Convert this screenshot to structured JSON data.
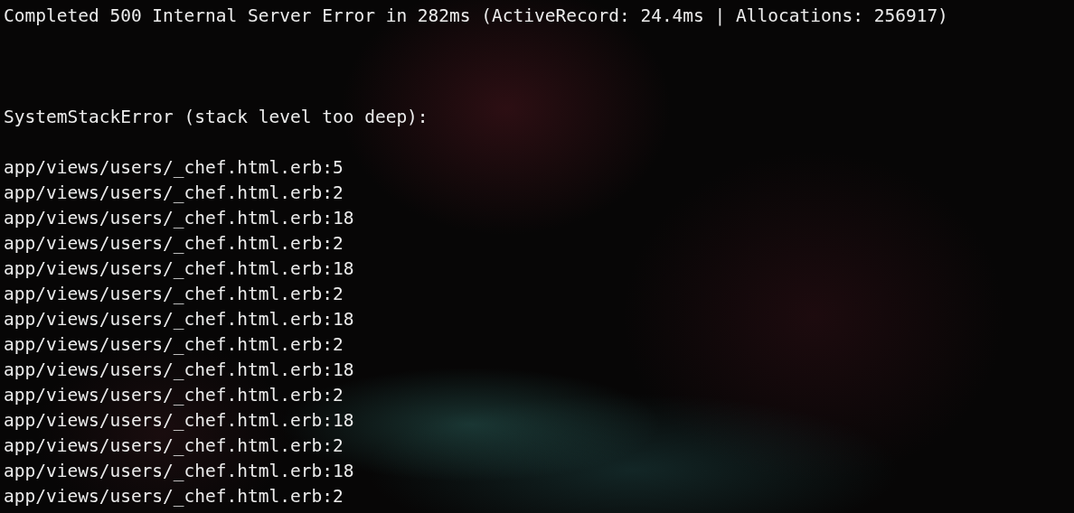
{
  "terminal": {
    "summary": "Completed 500 Internal Server Error in 282ms (ActiveRecord: 24.4ms | Allocations: 256917)",
    "error": "SystemStackError (stack level too deep):",
    "stack_trace": [
      "app/views/users/_chef.html.erb:5",
      "app/views/users/_chef.html.erb:2",
      "app/views/users/_chef.html.erb:18",
      "app/views/users/_chef.html.erb:2",
      "app/views/users/_chef.html.erb:18",
      "app/views/users/_chef.html.erb:2",
      "app/views/users/_chef.html.erb:18",
      "app/views/users/_chef.html.erb:2",
      "app/views/users/_chef.html.erb:18",
      "app/views/users/_chef.html.erb:2",
      "app/views/users/_chef.html.erb:18",
      "app/views/users/_chef.html.erb:2",
      "app/views/users/_chef.html.erb:18",
      "app/views/users/_chef.html.erb:2"
    ]
  }
}
